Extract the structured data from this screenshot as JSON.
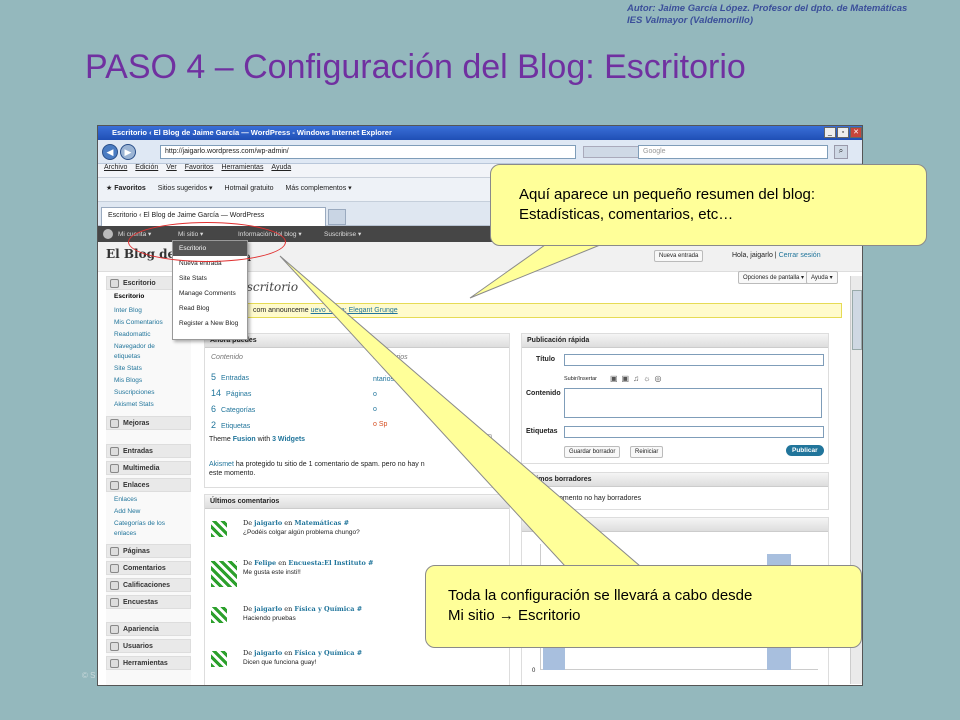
{
  "slide": {
    "author_line1": "Autor: Jaime García López. Profesor del dpto. de Matemáticas",
    "author_line2": "IES Valmayor (Valdemorillo)",
    "title": "PASO 4 – Configuración del Blog: Escritorio",
    "copyright": "© S"
  },
  "browser": {
    "title": "Escritorio ‹ El Blog de Jaime García — WordPress - Windows Internet Explorer",
    "url": "http://jaigarlo.wordpress.com/wp-admin/",
    "search_placeholder": "Google",
    "menu": [
      "Archivo",
      "Edición",
      "Ver",
      "Favoritos",
      "Herramientas",
      "Ayuda"
    ],
    "favorites": [
      "Favoritos",
      "Sitios sugeridos ▾",
      "Hotmail gratuito",
      "Más complementos ▾"
    ],
    "tab": "Escritorio ‹ El Blog de Jaime García — WordPress"
  },
  "wpbar": {
    "items": [
      "Mi cuenta ▾",
      "Mi sitio ▾",
      "Información del blog ▾",
      "Suscribirse ▾"
    ],
    "new_entry": "Nueva entrada",
    "hello": "Hola, jaigarlo",
    "logout": "Cerrar sesión"
  },
  "dropdown": [
    "Escritorio",
    "Nueva entrada",
    "Site Stats",
    "Manage Comments",
    "Read Blog",
    "Register a New Blog"
  ],
  "header": {
    "blog_title": "El Blog de",
    "title_suffix": "a",
    "page_title": "Escritorio",
    "screen_options": "Opciones de pantalla ▾",
    "help": "Ayuda ▾"
  },
  "notice": {
    "text": "com announceme",
    "link": "uevo Tema: Elegant Grunge"
  },
  "sidebar": {
    "dashboard": "Escritorio",
    "dash_items": [
      "Escritorio",
      "Inter Blog",
      "Mis Comentarios",
      "Readomattic",
      "Navegador de",
      "etiquetas",
      "Site Stats",
      "Mis Blogs",
      "Suscripciones",
      "Akismet Stats"
    ],
    "mejoras": "Mejoras",
    "entradas": "Entradas",
    "multimedia": "Multimedia",
    "enlaces": "Enlaces",
    "enlaces_items": [
      "Enlaces",
      "Add New",
      "Categorías de los",
      "enlaces"
    ],
    "paginas": "Páginas",
    "comentarios": "Comentarios",
    "calificaciones": "Calificaciones",
    "encuestas": "Encuestas",
    "apariencia": "Apariencia",
    "usuarios": "Usuarios",
    "herramientas": "Herramientas"
  },
  "ahora": {
    "title": "Ahora puedes",
    "col1": "Contenido",
    "col2": "omentarios",
    "rows": [
      {
        "n": "5",
        "label": "Entradas"
      },
      {
        "n": "14",
        "label": "Páginas"
      },
      {
        "n": "6",
        "label": "Categorías"
      },
      {
        "n": "2",
        "label": "Etiquetas"
      }
    ],
    "right_items": [
      "ntarios",
      "o",
      "o",
      "o Sp"
    ],
    "theme_prefix": "Theme",
    "theme": "Fusion",
    "with": "with",
    "widgets": "3 Widgets",
    "change_theme": "biar tema",
    "akismet_a": "Akismet",
    "akismet_b": "ha protegido tu sitio de 1 comentario de spam. pero no hay n",
    "akismet_c": "este momento."
  },
  "comments": {
    "title": "Últimos comentarios",
    "items": [
      {
        "by": "De",
        "author": "jaigarlo",
        "on": "en",
        "post": "Matemáticas #",
        "text": "¿Podéis colgar algún problema chungo?"
      },
      {
        "by": "De",
        "author": "Felipe",
        "on": "en",
        "post": "Encuesta:El Instituto #",
        "text": "Me gusta este insti!!"
      },
      {
        "by": "De",
        "author": "jaigarlo",
        "on": "en",
        "post": "Física y Química #",
        "text": "Haciendo pruebas"
      },
      {
        "by": "De",
        "author": "jaigarlo",
        "on": "en",
        "post": "Física y Química #",
        "text": "Dicen que funciona guay!"
      }
    ]
  },
  "quick": {
    "title": "Publicación rápida",
    "titulo": "Título",
    "subir": "Subir/Insertar",
    "contenido": "Contenido",
    "etiquetas": "Etiquetas",
    "save": "Guardar borrador",
    "reset": "Reiniciar",
    "publish": "Publicar"
  },
  "drafts": {
    "title": "Últimos borradores",
    "text": "este momento no hay borradores"
  },
  "stats": {
    "title_suffix": "as",
    "zero_label": "0"
  },
  "callouts": {
    "top_line1": "Aquí aparece un pequeño resumen del blog:",
    "top_line2": "Estadísticas, comentarios, etc…",
    "bottom_line1": "Toda la configuración se llevará a cabo desde",
    "bottom_line2": "Mi sitio  Escritorio",
    "bottom_arrow": "→"
  },
  "colors": {
    "title": "#7030a0",
    "callout": "#ffff99",
    "wp_link": "#21759b",
    "wpbar": "#464646"
  }
}
